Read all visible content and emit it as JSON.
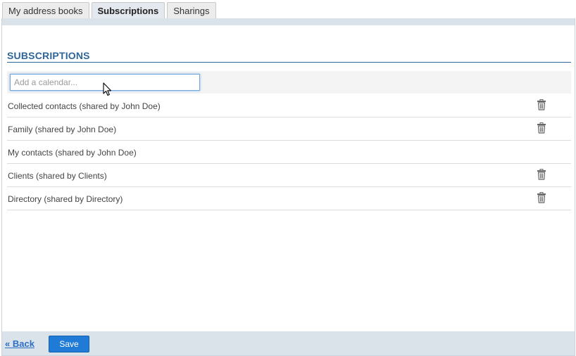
{
  "tabs": [
    {
      "label": "My address books",
      "active": false
    },
    {
      "label": "Subscriptions",
      "active": true
    },
    {
      "label": "Sharings",
      "active": false
    }
  ],
  "section": {
    "title": "SUBSCRIPTIONS"
  },
  "add": {
    "placeholder": "Add a calendar...",
    "value": ""
  },
  "subscriptions": [
    {
      "label": "Collected contacts (shared by John Doe)",
      "deletable": true,
      "icon": "trash-icon"
    },
    {
      "label": "Family (shared by John Doe)",
      "deletable": true,
      "icon": "trash-icon"
    },
    {
      "label": "My contacts (shared by John Doe)",
      "deletable": false
    },
    {
      "label": "Clients (shared by Clients)",
      "deletable": true,
      "icon": "trash-icon"
    },
    {
      "label": "Directory (shared by Directory)",
      "deletable": true,
      "icon": "trash-icon"
    }
  ],
  "footer": {
    "back_label": "« Back",
    "save_label": "Save"
  },
  "colors": {
    "accent": "#2d6599",
    "button": "#1f7bd6",
    "band": "#dbe3ea"
  }
}
